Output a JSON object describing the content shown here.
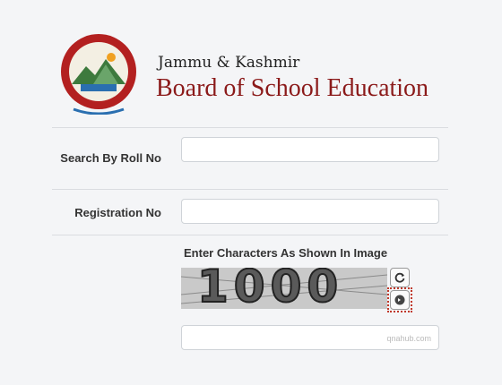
{
  "brand": {
    "line1": "Jammu & Kashmir",
    "line2": "Board of School Education"
  },
  "form": {
    "roll_label": "Search By Roll No",
    "roll_value": "",
    "registration_label": "Registration No",
    "registration_value": "",
    "captcha_title": "Enter Characters As Shown In Image",
    "captcha_text": "1000",
    "captcha_input_value": "",
    "watermark": "qnahub.com"
  },
  "icons": {
    "refresh": "refresh-icon",
    "audio": "audio-icon"
  },
  "colors": {
    "brand_red": "#8b1a1a",
    "background": "#f4f5f7"
  }
}
